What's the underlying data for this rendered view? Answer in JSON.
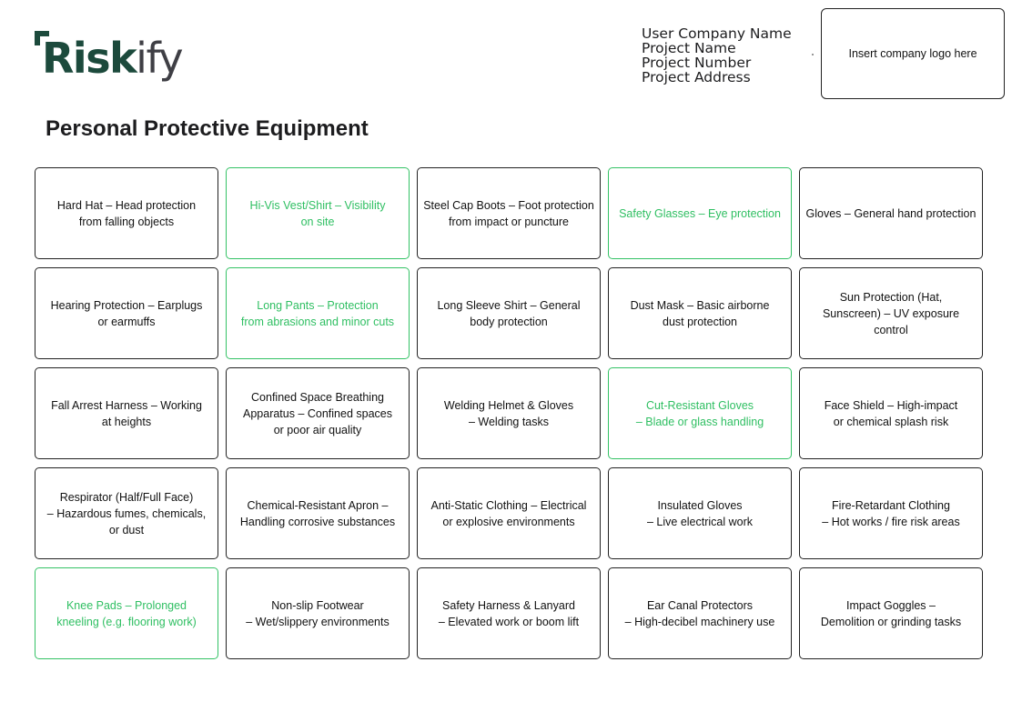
{
  "header": {
    "logo_text": "Riskify",
    "project_info": [
      "User Company Name",
      "Project Name",
      "Project Number",
      "Project Address"
    ],
    "logo_placeholder": "Insert company logo here"
  },
  "title": "Personal Protective Equipment",
  "colors": {
    "brand": "#1c4a3c",
    "highlight": "#2fbf62",
    "border": "#222222"
  },
  "items": [
    {
      "text": "Hard Hat – Head protection\nfrom falling objects",
      "highlight": false
    },
    {
      "text": "Hi-Vis Vest/Shirt – Visibility\non site",
      "highlight": true
    },
    {
      "text": "Steel Cap Boots – Foot protection\nfrom impact or puncture",
      "highlight": false
    },
    {
      "text": "Safety Glasses – Eye protection",
      "highlight": true
    },
    {
      "text": "Gloves – General hand protection",
      "highlight": false
    },
    {
      "text": "Hearing Protection – Earplugs\nor earmuffs",
      "highlight": false
    },
    {
      "text": "Long Pants – Protection\nfrom abrasions and minor cuts",
      "highlight": true
    },
    {
      "text": "Long Sleeve Shirt – General\nbody protection",
      "highlight": false
    },
    {
      "text": "Dust Mask – Basic airborne\ndust protection",
      "highlight": false
    },
    {
      "text": "Sun Protection (Hat,\nSunscreen) – UV exposure\ncontrol",
      "highlight": false
    },
    {
      "text": "Fall Arrest Harness – Working\nat heights",
      "highlight": false
    },
    {
      "text": "Confined Space Breathing\nApparatus – Confined spaces\nor poor air quality",
      "highlight": false
    },
    {
      "text": "Welding Helmet & Gloves\n– Welding tasks",
      "highlight": false
    },
    {
      "text": "Cut-Resistant Gloves\n– Blade or glass handling",
      "highlight": true
    },
    {
      "text": "Face Shield – High-impact\nor chemical splash risk",
      "highlight": false
    },
    {
      "text": "Respirator (Half/Full Face)\n– Hazardous fumes, chemicals,\nor dust",
      "highlight": false
    },
    {
      "text": "Chemical-Resistant Apron –\nHandling corrosive substances",
      "highlight": false
    },
    {
      "text": "Anti-Static Clothing – Electrical\nor explosive environments",
      "highlight": false
    },
    {
      "text": "Insulated Gloves\n– Live electrical work",
      "highlight": false
    },
    {
      "text": "Fire-Retardant Clothing\n– Hot works / fire risk areas",
      "highlight": false
    },
    {
      "text": "Knee Pads – Prolonged\nkneeling (e.g. flooring work)",
      "highlight": true
    },
    {
      "text": "Non-slip Footwear\n– Wet/slippery environments",
      "highlight": false
    },
    {
      "text": "Safety Harness & Lanyard\n– Elevated work or boom lift",
      "highlight": false
    },
    {
      "text": "Ear Canal Protectors\n– High-decibel machinery use",
      "highlight": false
    },
    {
      "text": "Impact Goggles –\nDemolition or grinding tasks",
      "highlight": false
    }
  ]
}
